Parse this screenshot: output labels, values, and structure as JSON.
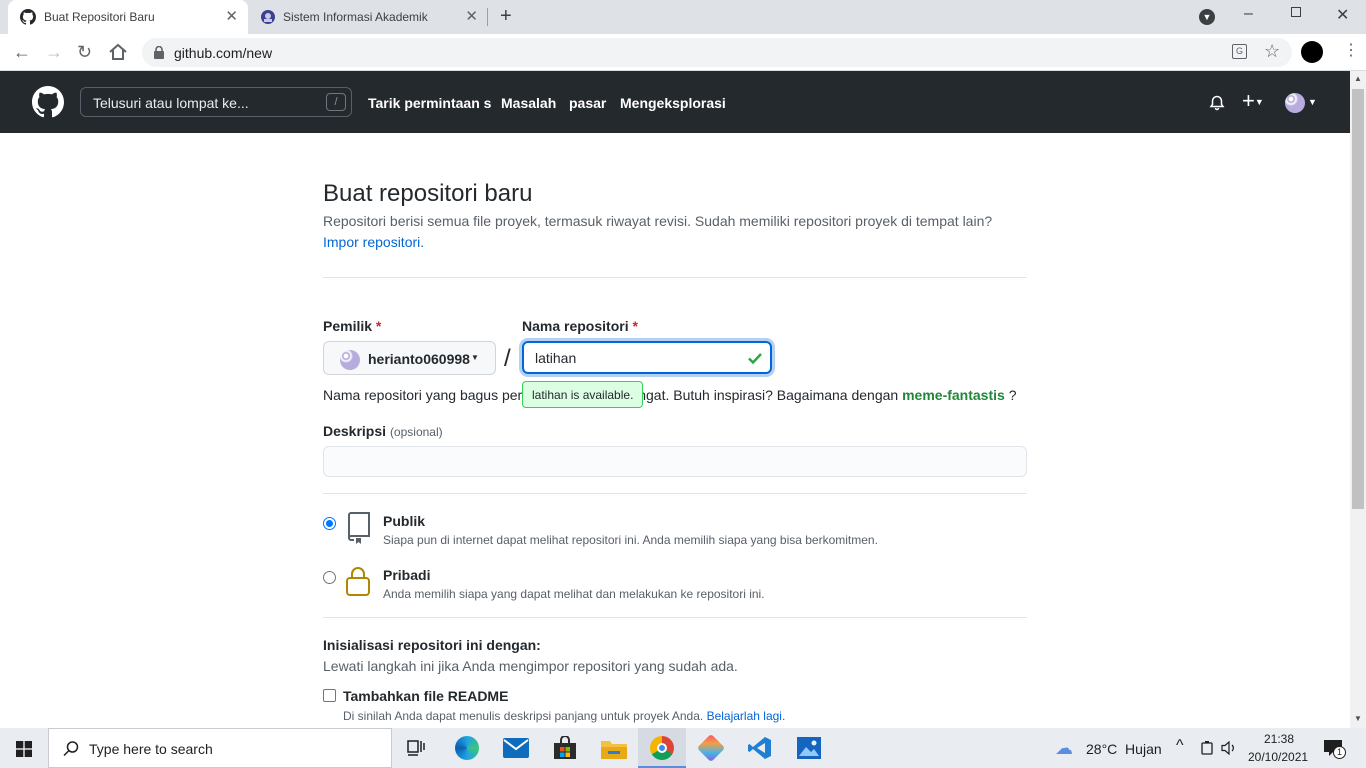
{
  "browser": {
    "tabs": [
      {
        "title": "Buat Repositori Baru",
        "icon": "github-icon"
      },
      {
        "title": "Sistem Informasi Akademik",
        "icon": "campus-icon"
      }
    ],
    "url": "github.com/new"
  },
  "github_header": {
    "search_placeholder": "Telusuri atau lompat ke...",
    "search_shortcut": "/",
    "nav": [
      "Tarik permintaan s",
      "Masalah",
      "pasar",
      "Mengeksplorasi"
    ]
  },
  "page": {
    "title": "Buat repositori baru",
    "subtitle": "Repositori berisi semua file proyek, termasuk riwayat revisi. Sudah memiliki repositori proyek di tempat lain?",
    "import_link": "Impor repositori.",
    "owner_label": "Pemilik",
    "required_mark": "*",
    "owner_value": "herianto060998",
    "separator": "/",
    "repo_label": "Nama repositori",
    "repo_value": "latihan",
    "availability_tooltip": "latihan is available.",
    "name_hint_start": "Nama repositori yang bagus per",
    "name_hint_end": "ngat. Butuh inspirasi? Bagaimana dengan",
    "name_suggestion": "meme-fantastis",
    "name_hint_tail": "?",
    "description_label": "Deskripsi",
    "description_optional": "(opsional)",
    "description_value": "",
    "visibility": [
      {
        "label": "Publik",
        "desc": "Siapa pun di internet dapat melihat repositori ini. Anda memilih siapa yang bisa berkomitmen.",
        "selected": true,
        "icon": "repo-book-icon"
      },
      {
        "label": "Pribadi",
        "desc": "Anda memilih siapa yang dapat melihat dan melakukan ke repositori ini.",
        "selected": false,
        "icon": "lock-icon"
      }
    ],
    "init_heading": "Inisialisasi repositori ini dengan:",
    "init_sub": "Lewati langkah ini jika Anda mengimpor repositori yang sudah ada.",
    "readme_label": "Tambahkan file README",
    "readme_desc": "Di sinilah Anda dapat menulis deskripsi panjang untuk proyek Anda.",
    "readme_link": "Belajarlah lagi."
  },
  "taskbar": {
    "search_placeholder": "Type here to search",
    "weather": "28°C  Hujan",
    "time": "21:38",
    "date": "20/10/2021",
    "notification_count": "1"
  },
  "colors": {
    "github_header": "#24292e",
    "link": "#0366d6",
    "success": "#28a745",
    "lock": "#b08800"
  }
}
